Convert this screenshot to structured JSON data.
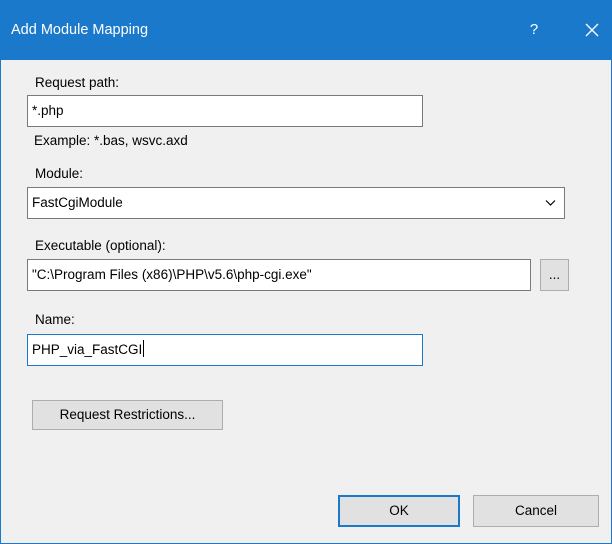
{
  "window": {
    "title": "Add Module Mapping",
    "help_label": "?",
    "close_icon": "close-icon"
  },
  "colors": {
    "titlebar": "#1a79ca",
    "dialog_background": "#f0f0f0",
    "focus_border": "#1979ca"
  },
  "form": {
    "request_path": {
      "label": "Request path:",
      "value": "*.php",
      "example": "Example: *.bas, wsvc.axd"
    },
    "module": {
      "label": "Module:",
      "selected": "FastCgiModule",
      "icon": "chevron-down-icon"
    },
    "executable": {
      "label": "Executable (optional):",
      "value": "\"C:\\Program Files (x86)\\PHP\\v5.6\\php-cgi.exe\"",
      "browse_label": "..."
    },
    "name": {
      "label": "Name:",
      "value": "PHP_via_FastCGI"
    },
    "request_restrictions_label": "Request Restrictions..."
  },
  "buttons": {
    "ok_label": "OK",
    "cancel_label": "Cancel"
  }
}
